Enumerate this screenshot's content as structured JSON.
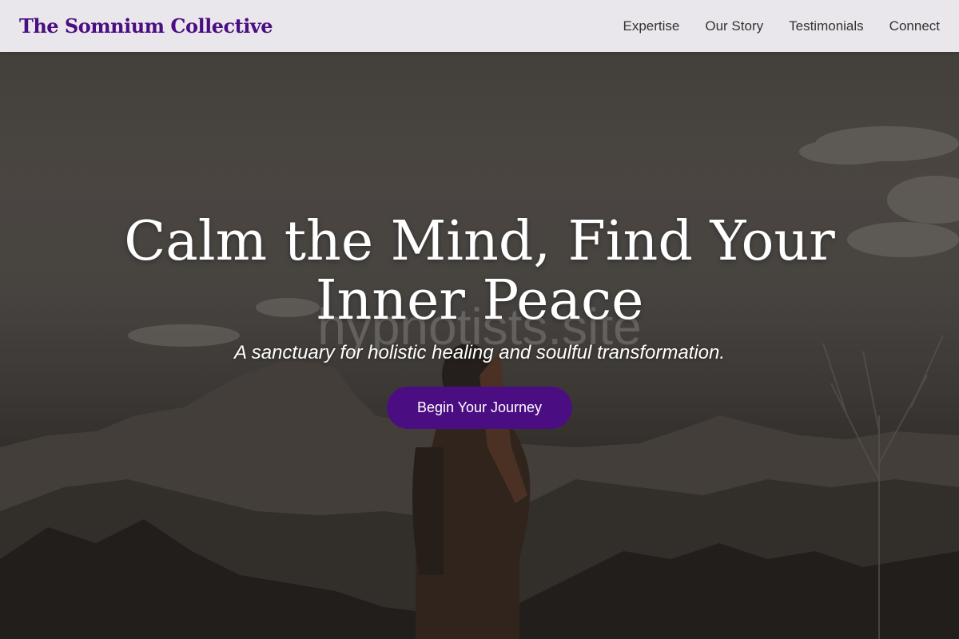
{
  "header": {
    "logo": "The Somnium Collective",
    "nav": [
      "Expertise",
      "Our Story",
      "Testimonials",
      "Connect"
    ]
  },
  "hero": {
    "headline": "Calm the Mind, Find Your Inner Peace",
    "tagline": "A sanctuary for holistic healing and soulful transformation.",
    "cta_label": "Begin Your Journey",
    "watermark": "hypnotists.site",
    "background_image": "woman-on-mountain-photo"
  },
  "colors": {
    "brand_purple": "#4b0e82",
    "header_bg": "#f0eef2",
    "hero_text": "#ffffff"
  }
}
